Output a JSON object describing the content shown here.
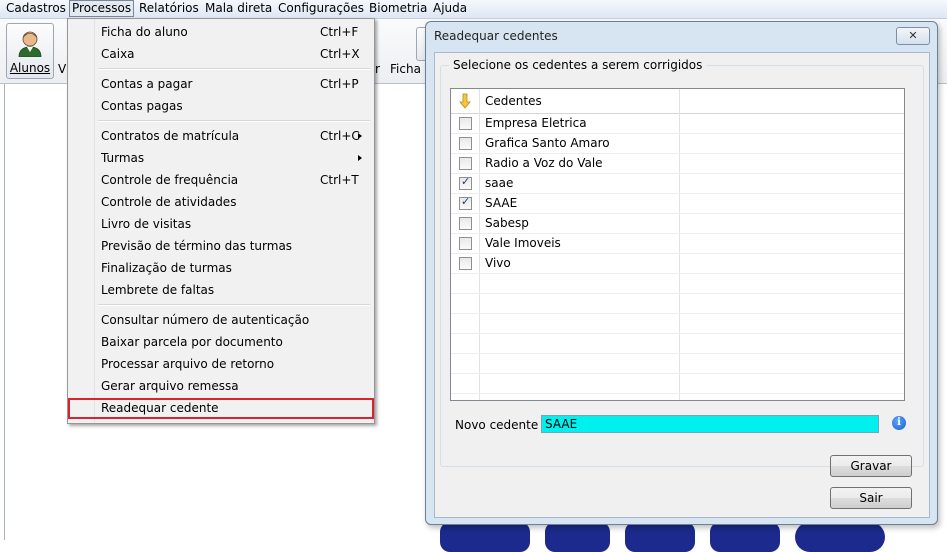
{
  "menubar": {
    "items": [
      "Cadastros",
      "Processos",
      "Relatórios",
      "Mala direta",
      "Configurações",
      "Biometria",
      "Ajuda"
    ],
    "active_index": 1
  },
  "toolbar": {
    "alunos_label": "Alunos",
    "partial_text_1": "V",
    "partial_text_2": "r",
    "partial_text_3": "Ficha o"
  },
  "processos_menu": {
    "group1": [
      {
        "label": "Ficha do aluno",
        "shortcut": "Ctrl+F"
      },
      {
        "label": "Caixa",
        "shortcut": "Ctrl+X"
      }
    ],
    "group2": [
      {
        "label": "Contas a pagar",
        "shortcut": "Ctrl+P"
      },
      {
        "label": "Contas pagas",
        "shortcut": ""
      }
    ],
    "group3": [
      {
        "label": "Contratos de matrícula",
        "shortcut": "Ctrl+C"
      },
      {
        "label": "Turmas",
        "shortcut": ""
      },
      {
        "label": "Controle de frequência",
        "shortcut": "Ctrl+T"
      },
      {
        "label": "Controle de atividades",
        "shortcut": ""
      },
      {
        "label": "Livro de visitas",
        "shortcut": ""
      },
      {
        "label": "Previsão de término das turmas",
        "shortcut": ""
      },
      {
        "label": "Finalização de turmas",
        "shortcut": ""
      },
      {
        "label": "Lembrete de faltas",
        "shortcut": ""
      }
    ],
    "group4": [
      {
        "label": "Consultar número de autenticação",
        "shortcut": ""
      },
      {
        "label": "Baixar parcela por documento",
        "shortcut": ""
      },
      {
        "label": "Processar arquivo de retorno",
        "shortcut": ""
      },
      {
        "label": "Gerar arquivo remessa",
        "shortcut": ""
      },
      {
        "label": "Readequar cedente",
        "shortcut": ""
      }
    ]
  },
  "dialog": {
    "title": "Readequar cedentes",
    "close_glyph": "✕",
    "group_label": "Selecione os cedentes a serem corrigidos",
    "grid_header": "Cedentes",
    "rows": [
      {
        "name": "Empresa Eletrica",
        "checked": false
      },
      {
        "name": "Grafica Santo Amaro",
        "checked": false
      },
      {
        "name": "Radio a Voz do Vale",
        "checked": false
      },
      {
        "name": "saae",
        "checked": true
      },
      {
        "name": "SAAE",
        "checked": true
      },
      {
        "name": "Sabesp",
        "checked": false
      },
      {
        "name": "Vale Imoveis",
        "checked": false
      },
      {
        "name": "Vivo",
        "checked": false
      }
    ],
    "novo_cedente_label": "Novo cedente",
    "novo_cedente_value": "SAAE",
    "info_glyph": "i",
    "gravar_label": "Gravar",
    "sair_label": "Sair"
  },
  "colors": {
    "highlight_border": "#d9232e",
    "input_bg": "#00f0f0",
    "logo_blue": "#1b2a8c"
  }
}
